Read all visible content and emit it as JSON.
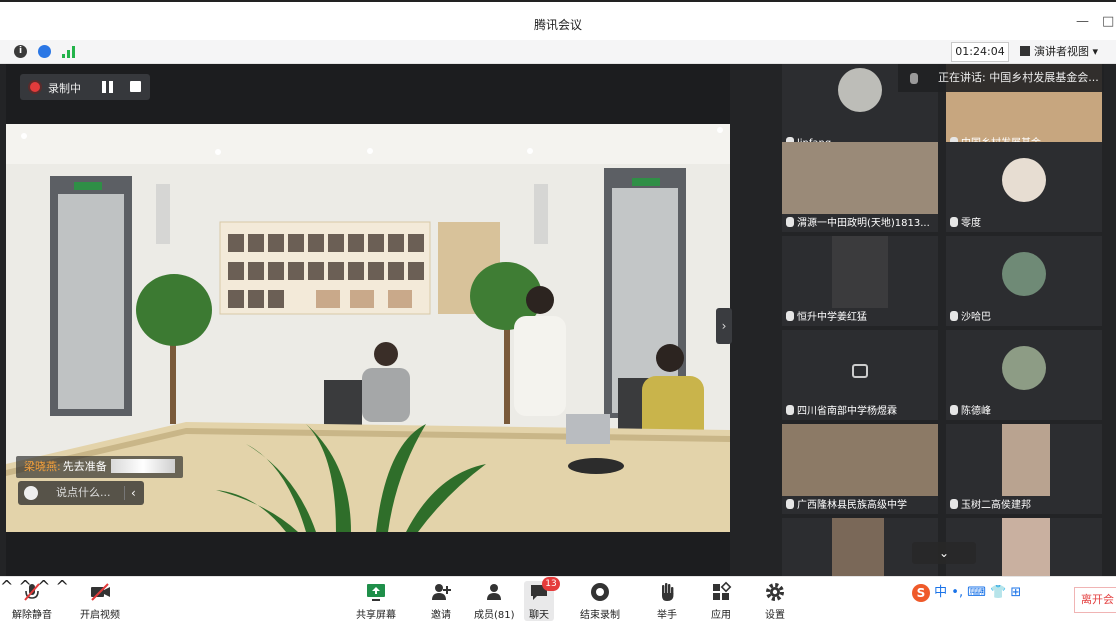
{
  "window": {
    "title": "腾讯会议",
    "minimize": "—",
    "maximize": "□"
  },
  "status": {
    "timer": "01:24:04",
    "view_label": "演讲者视图"
  },
  "recording": {
    "label": "录制中"
  },
  "chat": {
    "sender": "梁晓燕:",
    "message": "先去准备",
    "input_placeholder": "说点什么..."
  },
  "speaking": {
    "label": "正在讲话: 中国乡村发展基金会..."
  },
  "participants": [
    {
      "name": "linfang"
    },
    {
      "name": "中国乡村发展基金..."
    },
    {
      "name": "渭源一中田政明(天地)1813..."
    },
    {
      "name": "零度"
    },
    {
      "name": "恒升中学姜红猛"
    },
    {
      "name": "沙哈巴"
    },
    {
      "name": "四川省南部中学杨煜霖"
    },
    {
      "name": "陈德峰"
    },
    {
      "name": "广西隆林县民族高级中学"
    },
    {
      "name": "玉树二高侯建邦"
    }
  ],
  "toolbar": {
    "unmute": "解除静音",
    "start_video": "开启视频",
    "share_screen": "共享屏幕",
    "invite": "邀请",
    "members": "成员(81)",
    "chat": "聊天",
    "chat_badge": "13",
    "end_record": "结束录制",
    "raise_hand": "举手",
    "apps": "应用",
    "settings": "设置",
    "leave": "离开会"
  },
  "ime": {
    "text": "中 •, ⌨ 👕 ⊞"
  }
}
